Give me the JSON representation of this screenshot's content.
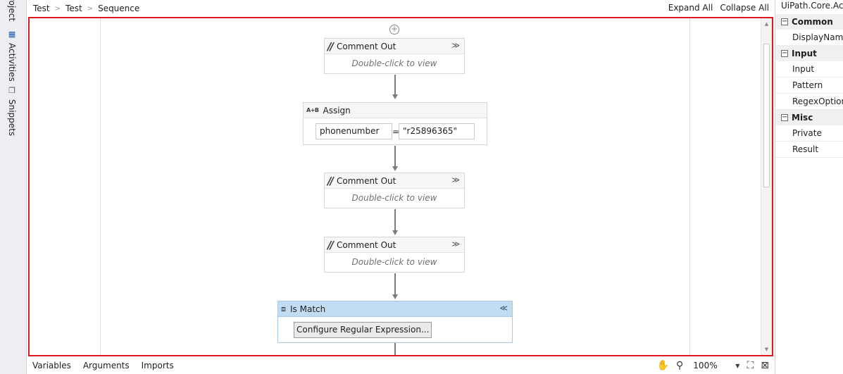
{
  "left_panel": {
    "tabs": [
      {
        "label": "Project",
        "icon": "project-icon"
      },
      {
        "label": "Activities",
        "icon": "activities-icon"
      },
      {
        "label": "Snippets",
        "icon": "snippets-icon"
      }
    ],
    "visible_fragments": {
      "project": "roject"
    }
  },
  "breadcrumb": [
    "Test",
    "Test",
    "Sequence"
  ],
  "toolbar": {
    "expand_all": "Expand All",
    "collapse_all": "Collapse All"
  },
  "activities": [
    {
      "type": "comment_out",
      "title": "Comment Out",
      "placeholder": "Double-click to view"
    },
    {
      "type": "assign",
      "title": "Assign",
      "to": "phonenumber",
      "value": "\"r25896365\""
    },
    {
      "type": "comment_out",
      "title": "Comment Out",
      "placeholder": "Double-click to view"
    },
    {
      "type": "comment_out",
      "title": "Comment Out",
      "placeholder": "Double-click to view"
    },
    {
      "type": "is_match",
      "title": "Is Match",
      "button": "Configure Regular Expression..."
    }
  ],
  "assign_icon_text": "A+B",
  "bottom_bar": {
    "tabs": [
      "Variables",
      "Arguments",
      "Imports"
    ],
    "zoom": "100%"
  },
  "properties": {
    "title": "UiPath.Core.Activ",
    "categories": [
      {
        "name": "Common",
        "items": [
          "DisplayName"
        ]
      },
      {
        "name": "Input",
        "items": [
          "Input",
          "Pattern",
          "RegexOption"
        ]
      },
      {
        "name": "Misc",
        "items": [
          "Private",
          "Result"
        ]
      }
    ]
  },
  "colors": {
    "selection_border": "#e0191e",
    "is_match_header": "#c2ddf2"
  }
}
